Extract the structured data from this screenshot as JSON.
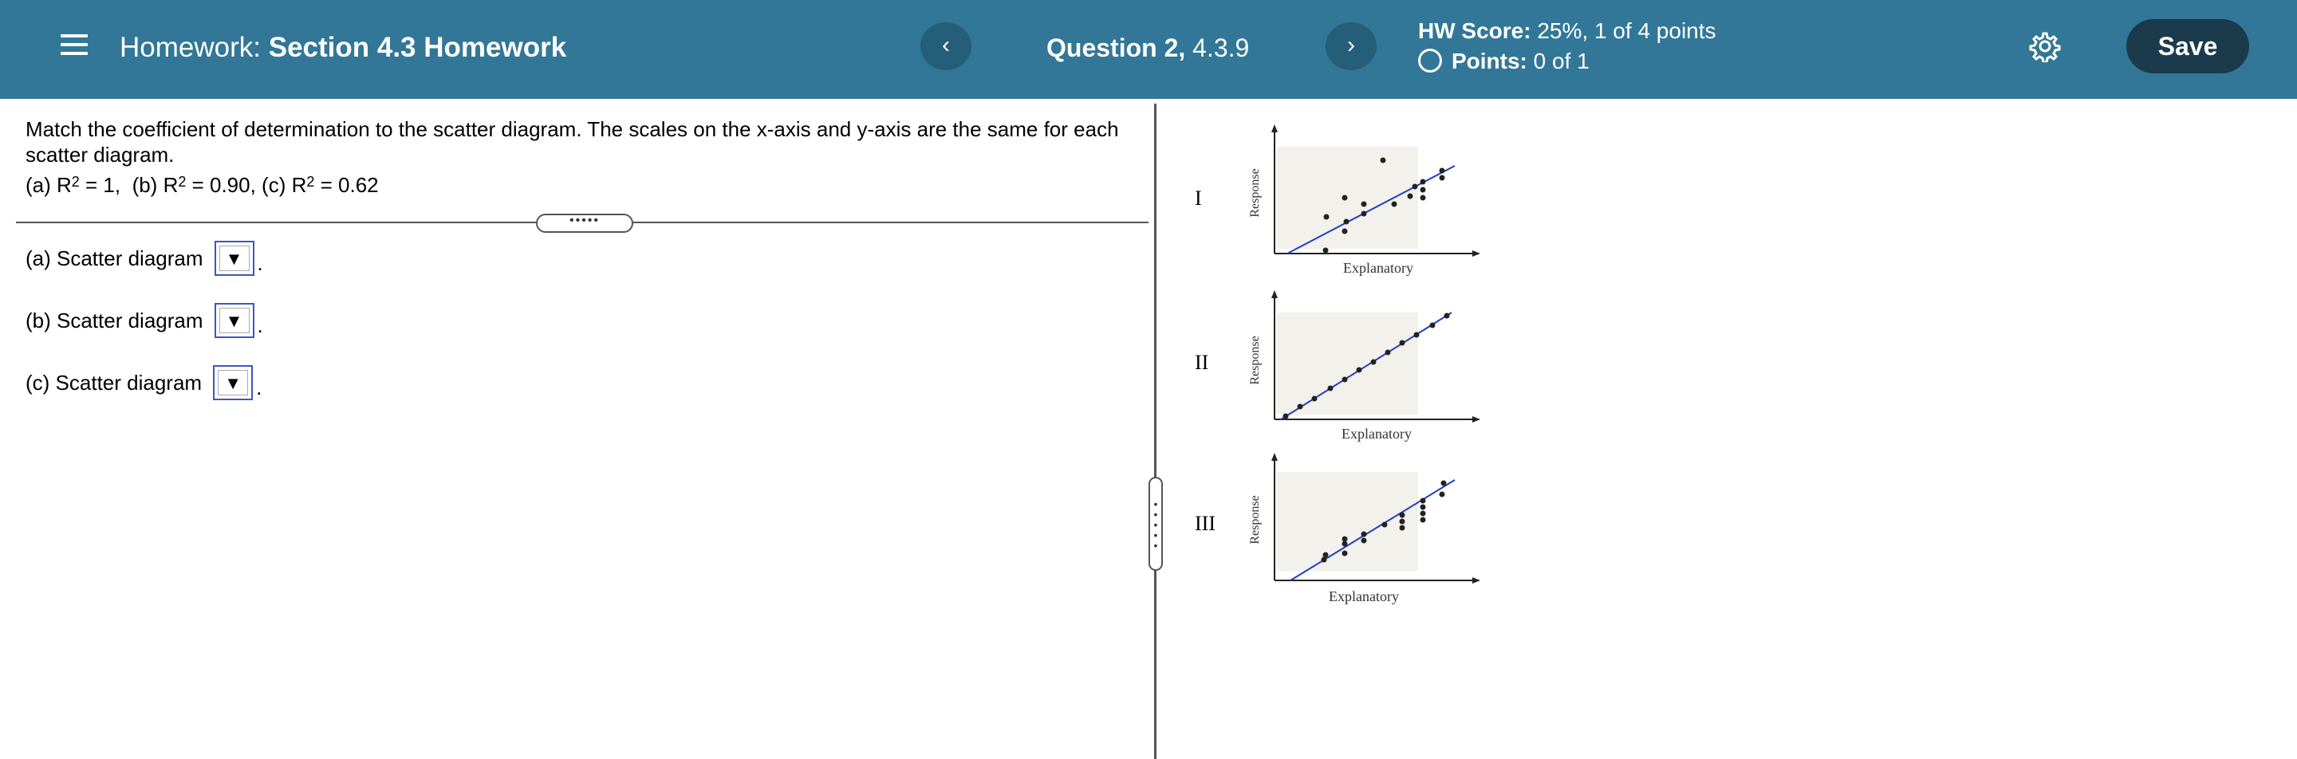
{
  "header": {
    "homework_prefix": "Homework:",
    "homework_title": "Section 4.3 Homework",
    "prev_label": "‹",
    "next_label": "›",
    "question_label": "Question 2,",
    "question_number": "4.3.9",
    "hw_score_label": "HW Score:",
    "hw_score_value": "25%, 1 of 4 points",
    "points_label": "Points:",
    "points_value": "0 of 1",
    "save_label": "Save"
  },
  "question": {
    "text": "Match the coefficient of determination to the scatter diagram. The scales on the x-axis and y-axis are the same for each scatter diagram.",
    "formula": {
      "a_prefix": "(a) R",
      "a_value": " = 1,  ",
      "b_prefix": "(b) R",
      "b_value": " = 0.90, ",
      "c_prefix": "(c) R",
      "c_value": " = 0.62",
      "exponent": "2"
    },
    "splitter_dots": "•••••"
  },
  "answers": [
    {
      "label": "(a) Scatter diagram",
      "selected": "▼"
    },
    {
      "label": "(b) Scatter diagram",
      "selected": "▼"
    },
    {
      "label": "(c) Scatter diagram",
      "selected": "▼"
    }
  ],
  "period": ".",
  "diagrams": [
    {
      "roman": "I",
      "xlabel": "Explanatory",
      "ylabel": "Response"
    },
    {
      "roman": "II",
      "xlabel": "Explanatory",
      "ylabel": "Response"
    },
    {
      "roman": "III",
      "xlabel": "Explanatory",
      "ylabel": "Response"
    }
  ],
  "colors": {
    "header_bg": "#327797",
    "save_bg": "#1b3a4c",
    "plot_bg": "#f3f1ec",
    "regression_line": "#1f3fbf"
  }
}
